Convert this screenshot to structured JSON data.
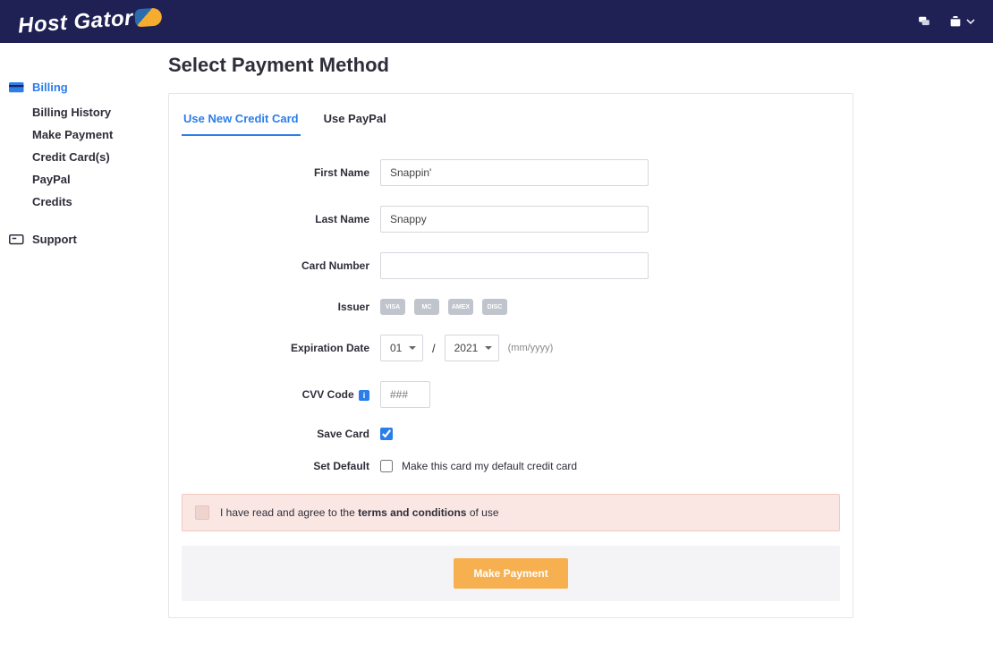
{
  "brand": {
    "name": "Host Gator"
  },
  "sidebar": {
    "billing": {
      "label": "Billing",
      "items": [
        "Billing History",
        "Make Payment",
        "Credit Card(s)",
        "PayPal",
        "Credits"
      ]
    },
    "support": {
      "label": "Support"
    }
  },
  "page": {
    "title": "Select Payment Method"
  },
  "tabs": {
    "new_card": "Use New Credit Card",
    "paypal": "Use PayPal"
  },
  "form": {
    "first_name": {
      "label": "First Name",
      "value": "Snappin'"
    },
    "last_name": {
      "label": "Last Name",
      "value": "Snappy"
    },
    "card_number": {
      "label": "Card Number",
      "value": ""
    },
    "issuer": {
      "label": "Issuer",
      "logos": [
        "VISA",
        "MC",
        "AMEX",
        "DISC"
      ]
    },
    "expiration": {
      "label": "Expiration Date",
      "month": "01",
      "year": "2021",
      "hint": "(mm/yyyy)",
      "sep": "/"
    },
    "cvv": {
      "label": "CVV Code",
      "placeholder": "###"
    },
    "save_card": {
      "label": "Save Card",
      "checked": true
    },
    "set_default": {
      "label": "Set Default",
      "text": "Make this card my default credit card",
      "checked": false
    }
  },
  "agree": {
    "pre": "I have read and agree to the ",
    "bold": "terms and conditions",
    "post": " of use"
  },
  "button": {
    "make_payment": "Make Payment"
  }
}
